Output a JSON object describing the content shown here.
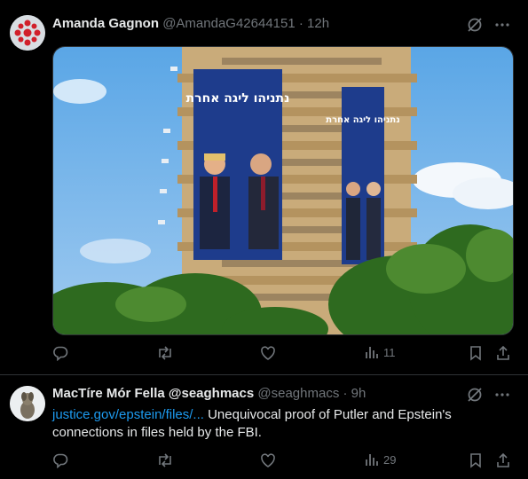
{
  "tweets": [
    {
      "author_name": "Amanda Gagnon",
      "handle": "@AmandaG42644151",
      "separator": "·",
      "time": "12h",
      "media": {
        "banner_left_text": "נתניהו ליגה אחרת",
        "banner_right_text": "נתניהו ליגה אחרת"
      },
      "stats": {
        "views": "11"
      }
    },
    {
      "author_name": "MacTíre Mór Fella @seaghmacs",
      "handle": "@seaghmacs",
      "separator": "·",
      "time": "9h",
      "link": "justice.gov/epstein/files/...",
      "body": " Unequivocal proof of Putler and Epstein's connections in files held by the FBI.",
      "stats": {
        "views": "29"
      }
    }
  ],
  "colors": {
    "background": "#000000",
    "text": "#e7e9ea",
    "muted": "#71767b",
    "link": "#1d9bf0",
    "divider": "#2f3336"
  },
  "icons": [
    "grok-icon",
    "more-icon",
    "reply-icon",
    "retweet-icon",
    "like-icon",
    "views-icon",
    "bookmark-icon",
    "share-icon"
  ]
}
